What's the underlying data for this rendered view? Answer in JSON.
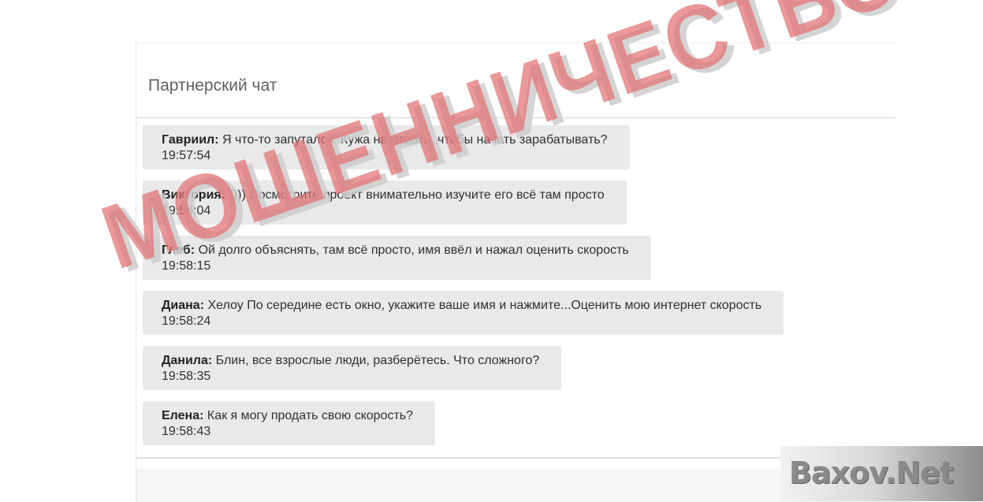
{
  "panel": {
    "title": "Партнерский чат"
  },
  "messages": [
    {
      "author": "Гавриил:",
      "text": " Я что-то запутался. Кужа нажимать, чтобы начать зарабатывать?",
      "time": "19:57:54"
    },
    {
      "author": "Виктория:",
      "text": " )))) Посмотрите проект внимательно изучите его всё там просто",
      "time": "19:58:04"
    },
    {
      "author": "Глеб:",
      "text": " Ой долго объяснять, там всё просто, имя ввёл и нажал оценить скорость",
      "time": "19:58:15"
    },
    {
      "author": "Диана:",
      "text": " Хелоу По середине есть окно, укажите ваше имя и нажмите...Оценить мою интернет скорость",
      "time": "19:58:24"
    },
    {
      "author": "Данила:",
      "text": " Блин, все взрослые люди, разберётесь. Что сложного?",
      "time": "19:58:35"
    },
    {
      "author": "Елена:",
      "text": " Как я могу продать свою скорость?",
      "time": "19:58:43"
    }
  ],
  "stamp": {
    "text": "МОШЕННИЧЕСТВО"
  },
  "watermark": {
    "text": "Baxov.Net"
  }
}
